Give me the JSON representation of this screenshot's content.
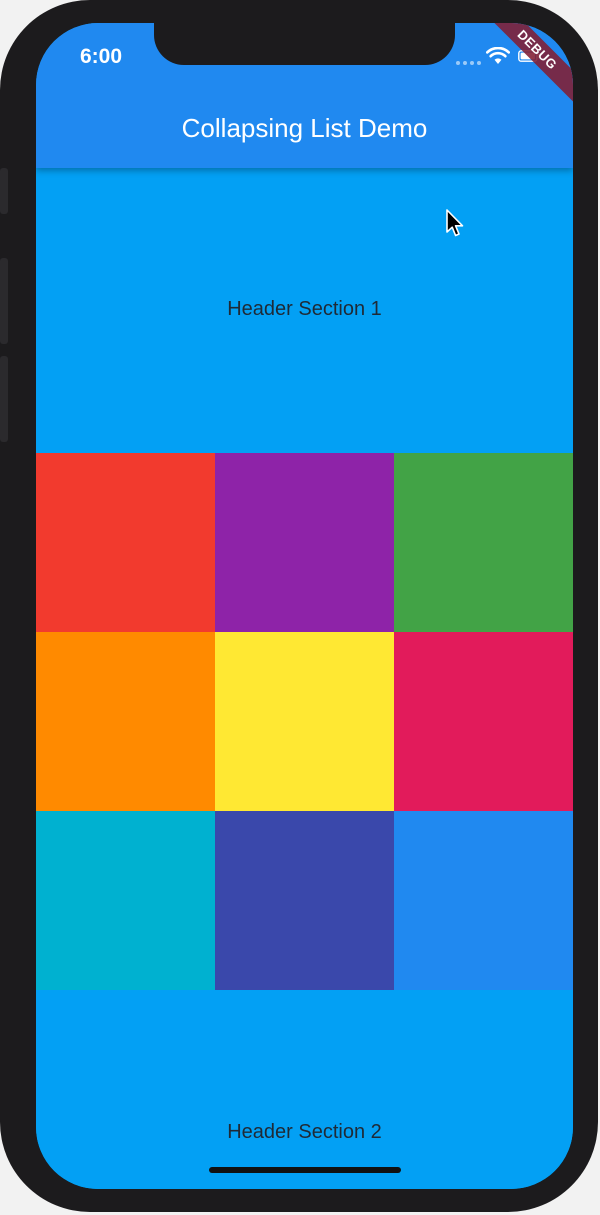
{
  "status_bar": {
    "time": "6:00"
  },
  "debug_banner": {
    "label": "DEBUG"
  },
  "app_bar": {
    "title": "Collapsing List Demo",
    "color": "#2089f0"
  },
  "sections": [
    {
      "header": "Header Section 1",
      "color": "#03a0f4"
    },
    {
      "header": "Header Section 2",
      "color": "#03a0f4"
    }
  ],
  "grid": {
    "colors": [
      "#f23a2e",
      "#8e23a8",
      "#42a346",
      "#ff8a00",
      "#ffe833",
      "#e21b5b",
      "#00b1d0",
      "#3a48ab",
      "#2089f0"
    ]
  }
}
